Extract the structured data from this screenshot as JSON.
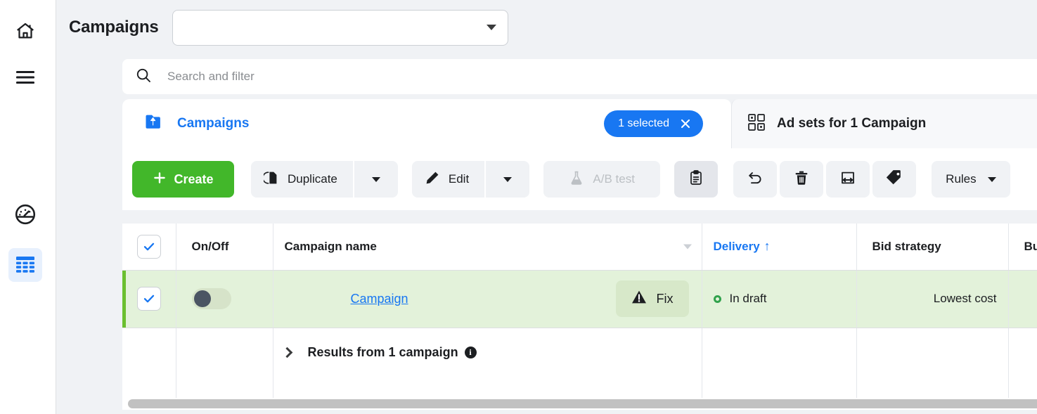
{
  "colors": {
    "brand_blue": "#1877f2",
    "create_green": "#42b72a",
    "row_green_bg": "#e3f2da",
    "row_accent_green": "#6bbf2f",
    "status_green": "#31a24c",
    "page_bg": "#f0f2f5",
    "toggle_knob": "#4b5563"
  },
  "sidebar": {
    "items": [
      {
        "name": "home-icon",
        "label": "Home",
        "active": false
      },
      {
        "name": "menu-icon",
        "label": "All tools",
        "active": false
      },
      {
        "name": "gauge-icon",
        "label": "Performance",
        "active": false
      },
      {
        "name": "table-icon",
        "label": "Ads Manager",
        "active": true
      }
    ]
  },
  "header": {
    "title": "Campaigns",
    "account_select": {
      "value": "",
      "placeholder": ""
    }
  },
  "search": {
    "icon": "search-icon",
    "value": "",
    "placeholder": "Search and filter"
  },
  "tabs": [
    {
      "id": "campaigns",
      "icon": "campaign-folder-icon",
      "label": "Campaigns",
      "active": true,
      "badge": {
        "label": "1 selected",
        "close_icon": "close-icon"
      }
    },
    {
      "id": "adsets",
      "icon": "ad-sets-grid-icon",
      "label": "Ad sets for 1 Campaign",
      "active": false
    }
  ],
  "toolbar": {
    "create_label": "Create",
    "create_icon": "plus-icon",
    "duplicate_label": "Duplicate",
    "duplicate_icon": "duplicate-icon",
    "duplicate_caret": "chevron-down-icon",
    "edit_label": "Edit",
    "edit_icon": "pencil-icon",
    "edit_caret": "chevron-down-icon",
    "abtest_label": "A/B test",
    "abtest_icon": "flask-icon",
    "abtest_disabled": true,
    "clipboard_icon": "clipboard-icon",
    "undo_icon": "undo-icon",
    "delete_icon": "trash-icon",
    "export_icon": "export-icon",
    "tag_icon": "tag-icon",
    "rules_label": "Rules",
    "rules_caret": "chevron-down-icon"
  },
  "table": {
    "columns": [
      {
        "key": "check",
        "label": "",
        "sorted": false
      },
      {
        "key": "onoff",
        "label": "On/Off",
        "sorted": false
      },
      {
        "key": "name",
        "label": "Campaign name",
        "sorted": false
      },
      {
        "key": "delivery",
        "label": "Delivery",
        "sorted": true,
        "sort_arrow": "↑"
      },
      {
        "key": "bid",
        "label": "Bid strategy",
        "sorted": false
      },
      {
        "key": "budget",
        "label": "Budget",
        "sorted": false
      }
    ],
    "header_select_all_checked": true,
    "rows": [
      {
        "selected": true,
        "checked": true,
        "toggle_on": false,
        "name": "Campaign",
        "fix_label": "Fix",
        "fix_icon": "warning-triangle-icon",
        "delivery": "In draft",
        "delivery_status_icon": "status-dot-draft",
        "bid_strategy": "Lowest cost",
        "budget": ""
      }
    ],
    "footer": {
      "expand_icon": "chevron-right-icon",
      "label": "Results from 1 campaign",
      "info_icon": "info-icon",
      "info_glyph": "i"
    }
  },
  "scrollbar": {
    "name": "horizontal-scrollbar",
    "orientation": "horizontal"
  }
}
